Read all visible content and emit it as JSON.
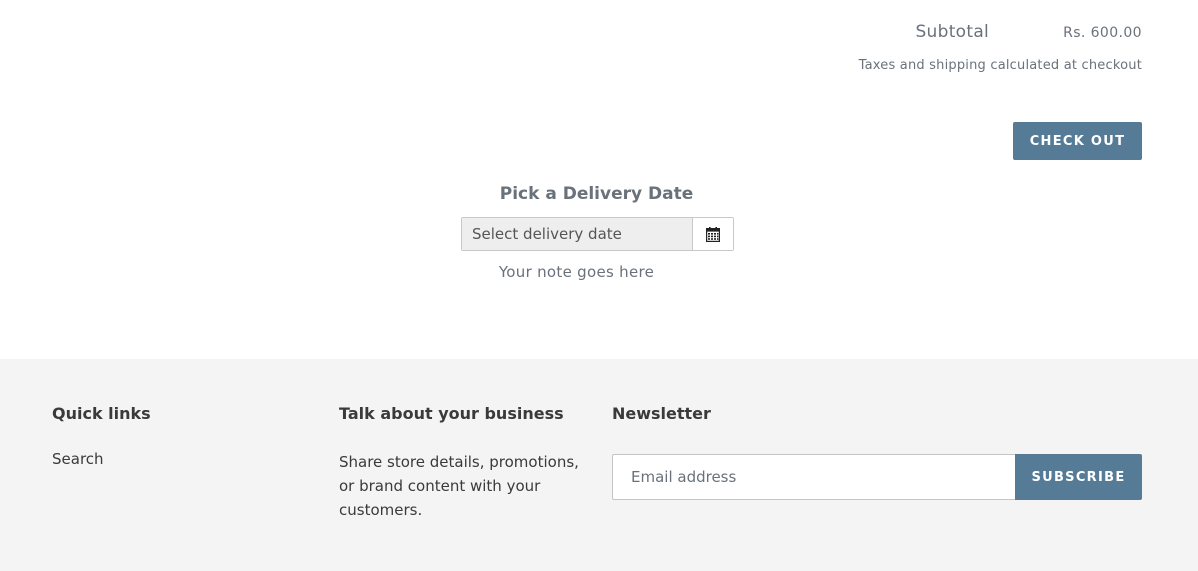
{
  "cart": {
    "subtotal_label": "Subtotal",
    "subtotal_value": "Rs. 600.00",
    "tax_note": "Taxes and shipping calculated at checkout",
    "checkout_label": "CHECK OUT"
  },
  "delivery": {
    "title": "Pick a Delivery Date",
    "date_placeholder": "Select delivery date",
    "calendar_icon": "calendar-icon",
    "note": "Your note goes here"
  },
  "footer": {
    "quick_links": {
      "heading": "Quick links",
      "items": [
        {
          "label": "Search"
        }
      ]
    },
    "business": {
      "heading": "Talk about your business",
      "text": "Share store details, promotions, or brand content with your customers."
    },
    "newsletter": {
      "heading": "Newsletter",
      "email_placeholder": "Email address",
      "subscribe_label": "SUBSCRIBE"
    }
  },
  "colors": {
    "accent": "#557b97",
    "footer_bg": "#f4f4f4",
    "text": "#3a3a3a",
    "muted": "#69727b"
  }
}
